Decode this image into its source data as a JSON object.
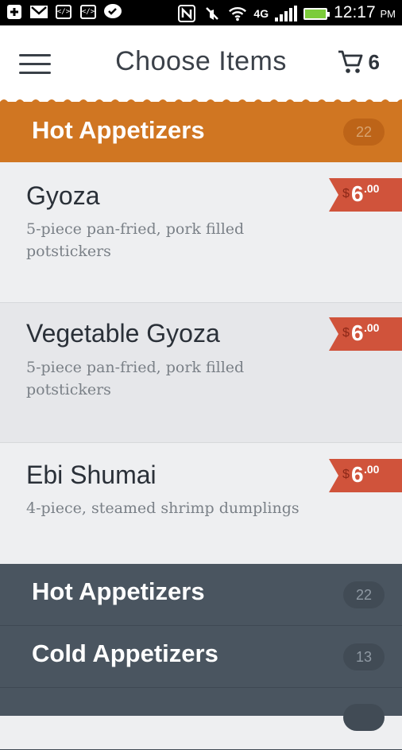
{
  "status_bar": {
    "time": "12:17",
    "ampm": "PM",
    "network": "4G",
    "icons": [
      "plus-icon",
      "gmail-icon",
      "code-icon",
      "code-icon",
      "chat-check-icon",
      "nfc-icon",
      "mute-icon",
      "wifi-icon",
      "signal-icon",
      "battery-icon"
    ]
  },
  "header": {
    "title": "Choose Items",
    "cart_count": "6",
    "icons": [
      "menu-icon",
      "cart-icon"
    ]
  },
  "colors": {
    "accent": "#d07622",
    "price_tag": "#d0533b",
    "dark_panel": "#4a5560",
    "text_dark": "#2a3038"
  },
  "category": {
    "title": "Hot Appetizers",
    "count": "22"
  },
  "items": [
    {
      "name": "Gyoza",
      "desc": "5-piece pan-fried, pork filled potstickers",
      "currency": "$",
      "price": "6",
      "cents": ".00"
    },
    {
      "name": "Vegetable Gyoza",
      "desc": "5-piece pan-fried, pork filled potstickers",
      "currency": "$",
      "price": "6",
      "cents": ".00"
    },
    {
      "name": "Ebi Shumai",
      "desc": "4-piece, steamed shrimp dumplings",
      "currency": "$",
      "price": "6",
      "cents": ".00"
    }
  ],
  "category_list": [
    {
      "title": "Hot Appetizers",
      "count": "22"
    },
    {
      "title": "Cold Appetizers",
      "count": "13"
    }
  ]
}
